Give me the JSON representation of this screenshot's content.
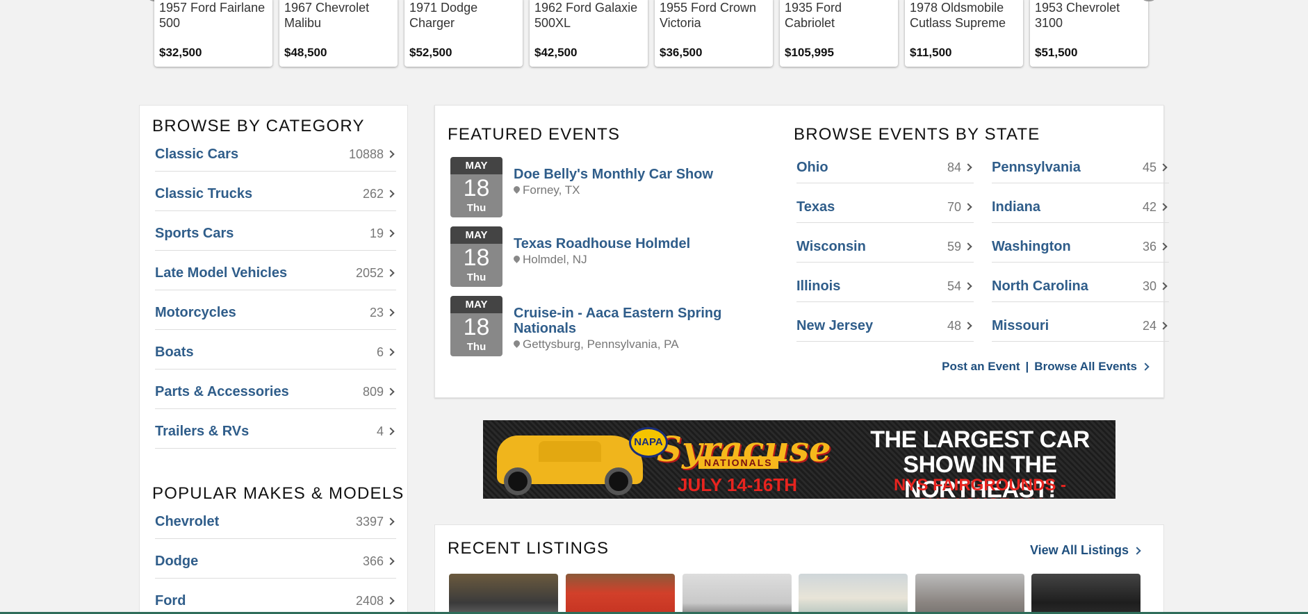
{
  "carousel": {
    "cards": [
      {
        "title": "1957 Ford Fairlane 500",
        "price": "$32,500"
      },
      {
        "title": "1967 Chevrolet Malibu",
        "price": "$48,500"
      },
      {
        "title": "1971 Dodge Charger",
        "price": "$52,500"
      },
      {
        "title": "1962 Ford Galaxie 500XL",
        "price": "$42,500"
      },
      {
        "title": "1955 Ford Crown Victoria",
        "price": "$36,500"
      },
      {
        "title": "1935 Ford Cabriolet",
        "price": "$105,995"
      },
      {
        "title": "1978 Oldsmobile Cutlass Supreme",
        "price": "$11,500"
      },
      {
        "title": "1953 Chevrolet 3100",
        "price": "$51,500"
      }
    ]
  },
  "browse_category": {
    "title": "BROWSE BY CATEGORY",
    "items": [
      {
        "name": "Classic Cars",
        "count": "10888"
      },
      {
        "name": "Classic Trucks",
        "count": "262"
      },
      {
        "name": "Sports Cars",
        "count": "19"
      },
      {
        "name": "Late Model Vehicles",
        "count": "2052"
      },
      {
        "name": "Motorcycles",
        "count": "23"
      },
      {
        "name": "Boats",
        "count": "6"
      },
      {
        "name": "Parts & Accessories",
        "count": "809"
      },
      {
        "name": "Trailers & RVs",
        "count": "4"
      }
    ]
  },
  "popular_makes": {
    "title": "POPULAR MAKES & MODELS",
    "items": [
      {
        "name": "Chevrolet",
        "count": "3397"
      },
      {
        "name": "Dodge",
        "count": "366"
      },
      {
        "name": "Ford",
        "count": "2408"
      }
    ]
  },
  "featured_events": {
    "title": "FEATURED EVENTS",
    "events": [
      {
        "month": "MAY",
        "day": "18",
        "dow": "Thu",
        "title": "Doe Belly's Monthly Car Show",
        "location": "Forney, TX"
      },
      {
        "month": "MAY",
        "day": "18",
        "dow": "Thu",
        "title": "Texas Roadhouse Holmdel",
        "location": "Holmdel, NJ"
      },
      {
        "month": "MAY",
        "day": "18",
        "dow": "Thu",
        "title": "Cruise-in - Aaca Eastern Spring Nationals",
        "location": "Gettysburg, Pennsylvania, PA"
      }
    ]
  },
  "events_by_state": {
    "title": "BROWSE EVENTS BY STATE",
    "left": [
      {
        "name": "Ohio",
        "count": "84"
      },
      {
        "name": "Texas",
        "count": "70"
      },
      {
        "name": "Wisconsin",
        "count": "59"
      },
      {
        "name": "Illinois",
        "count": "54"
      },
      {
        "name": "New Jersey",
        "count": "48"
      }
    ],
    "right": [
      {
        "name": "Pennsylvania",
        "count": "45"
      },
      {
        "name": "Indiana",
        "count": "42"
      },
      {
        "name": "Washington",
        "count": "36"
      },
      {
        "name": "North Carolina",
        "count": "30"
      },
      {
        "name": "Missouri",
        "count": "24"
      }
    ],
    "post_event": "Post an Event",
    "separator": "|",
    "browse_all": "Browse All Events"
  },
  "banner": {
    "napa": "NAPA",
    "brand": "Syracuse",
    "nationals": "NATIONALS",
    "dates": "JULY 14-16TH",
    "headline": "THE LARGEST CAR SHOW IN THE NORTHEAST!",
    "venue": "NYS FAIRGROUNDS - SYRACUSE, NY"
  },
  "recent_listings": {
    "title": "RECENT LISTINGS",
    "view_all": "View All Listings"
  },
  "colors": {
    "link": "#2f5d8a",
    "badge_top": "#444444",
    "badge_body": "#888888"
  }
}
